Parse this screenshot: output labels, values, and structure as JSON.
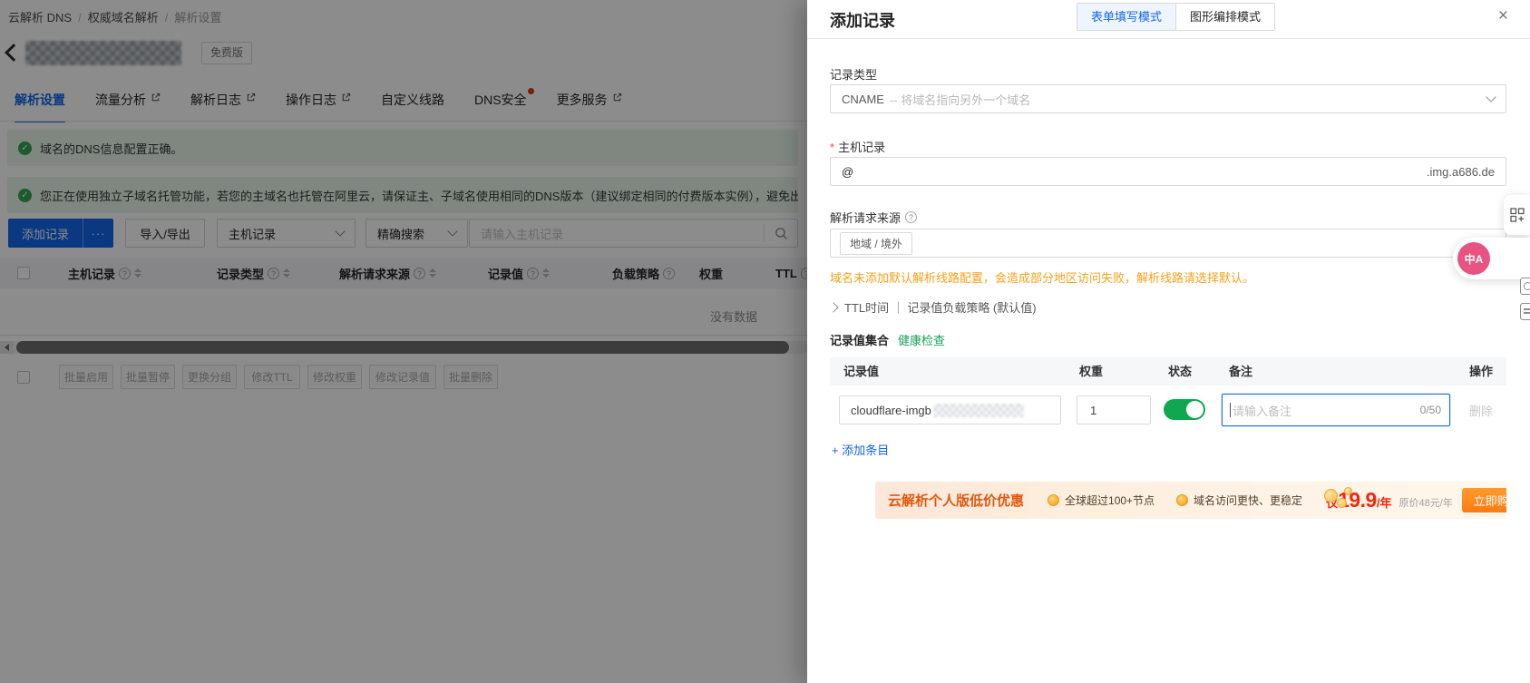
{
  "colors": {
    "primary_blue": "#1366ec",
    "success_green": "#31a84f",
    "link_green": "#18a058",
    "warning_orange": "#f7a11a",
    "price_red": "#f2270c",
    "buy_orange": "#ff7b12",
    "mask": "rgba(0,0,0,0.45)",
    "toggle_on": "#0fa750"
  },
  "icons": {
    "back": "chevron-left",
    "external": "external-link",
    "help": "?",
    "check": "✓",
    "search": "magnifier",
    "sort": "sort-arrows",
    "close": "×",
    "translate": "中A"
  },
  "page": {
    "breadcrumb": {
      "sep": "/",
      "items": [
        {
          "label": "云解析 DNS"
        },
        {
          "label": "权威域名解析"
        },
        {
          "label": "解析设置"
        }
      ]
    },
    "domain": {
      "plan": "免费版"
    },
    "tabs": [
      {
        "label": "解析设置"
      },
      {
        "label": "流量分析"
      },
      {
        "label": "解析日志"
      },
      {
        "label": "操作日志"
      },
      {
        "label": "自定义线路"
      },
      {
        "label": "DNS安全"
      },
      {
        "label": "更多服务"
      }
    ],
    "alerts": [
      {
        "text": "域名的DNS信息配置正确。"
      },
      {
        "text": "您正在使用独立子域名托管功能，若您的主域名也托管在阿里云，请保证主、子域名使用相同的DNS版本（建议绑定相同的付费版本实例），避免出现DNS解析异常"
      }
    ],
    "toolbar": {
      "add": "添加记录",
      "more": "···",
      "import_export": "导入/导出",
      "host_filter": "主机记录",
      "precise": "精确搜索",
      "search_placeholder": "请输入主机记录"
    },
    "table": {
      "headers": [
        "主机记录",
        "记录类型",
        "解析请求来源",
        "记录值",
        "负载策略",
        "权重",
        "TTL"
      ],
      "empty": "没有数据"
    },
    "batch": [
      "批量启用",
      "批量暂停",
      "更换分组",
      "修改TTL",
      "修改权重",
      "修改记录值",
      "批量删除"
    ]
  },
  "drawer": {
    "title": "添加记录",
    "close": "×",
    "mode_tabs": [
      {
        "label": "表单填写模式"
      },
      {
        "label": "图形编排模式"
      }
    ],
    "form": {
      "record_type": {
        "label": "记录类型",
        "value": "CNAME",
        "hint": "-- 将域名指向另外一个域名"
      },
      "host": {
        "label": "主机记录",
        "required": "*",
        "value": "@",
        "suffix": ".img.a686.de"
      },
      "source": {
        "label": "解析请求来源",
        "tag": "地域 / 境外"
      },
      "line_warning": "域名未添加默认解析线路配置，会造成部分地区访问失败，解析线路请选择默认。",
      "collapse": "TTL时间 ｜ 记录值负载策略 (默认值)",
      "value_set": {
        "label": "记录值集合",
        "health_check": "健康检查"
      }
    },
    "records_table": {
      "headers": [
        "记录值",
        "权重",
        "状态",
        "备注",
        "操作"
      ],
      "row": {
        "value": "cloudflare-imgb",
        "weight": "1",
        "status": "on",
        "remark_placeholder": "请输入备注",
        "remark_counter": "0/50",
        "delete_label": "删除"
      }
    },
    "add_entry": "+ 添加条目",
    "promo": {
      "title": "云解析个人版低价优惠",
      "point1": "全球超过100+节点",
      "point2": "域名访问更快、更稳定",
      "price_prefix": "仅",
      "price": "19.9",
      "price_unit": "/年",
      "original": "原价48元/年",
      "buy": "立即购买",
      "close": "×"
    },
    "rail": {
      "translate_text": "中A"
    }
  }
}
